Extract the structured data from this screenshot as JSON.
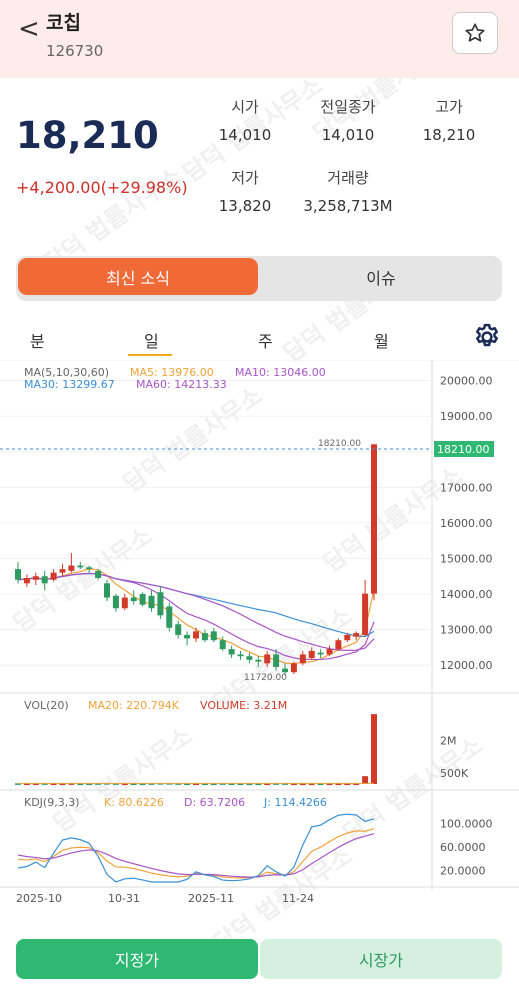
{
  "header": {
    "back_label": "<",
    "name": "코칩",
    "code": "126730"
  },
  "quote": {
    "price": "18,210",
    "change": "+4,200.00(+29.98%)",
    "stats": [
      {
        "label": "시가",
        "value": "14,010"
      },
      {
        "label": "전일종가",
        "value": "14,010"
      },
      {
        "label": "고가",
        "value": "18,210"
      },
      {
        "label": "저가",
        "value": "13,820"
      },
      {
        "label": "거래량",
        "value": "3,258,713M"
      }
    ]
  },
  "tabs": {
    "news": "최신 소식",
    "issues": "이슈"
  },
  "periods": [
    "분",
    "일",
    "주",
    "월"
  ],
  "chart": {
    "ma_header": "MA(5,10,30,60)",
    "ma5": "MA5: 13976.00",
    "ma10": "MA10: 13046.00",
    "ma30": "MA30: 13299.67",
    "ma60": "MA60: 14213.33",
    "max_label": "18210.00",
    "min_label": "11720.00",
    "last_price": "18210.00",
    "price_ticks": [
      "20000.00",
      "19000.00",
      "18000.00",
      "17000.00",
      "16000.00",
      "15000.00",
      "14000.00",
      "13000.00",
      "12000.00"
    ],
    "vol_header": "VOL(20)",
    "vol_ma": "MA20: 220.794K",
    "vol_value": "VOLUME: 3.21M",
    "vol_ticks": [
      "2M",
      "500K"
    ],
    "kdj_header": "KDJ(9,3,3)",
    "kdj_k": "K: 80.6226",
    "kdj_d": "D: 63.7206",
    "kdj_j": "J: 114.4266",
    "kdj_ticks": [
      "100.0000",
      "60.0000",
      "20.0000"
    ],
    "date_ticks": [
      "2025-10",
      "10-31",
      "2025-11",
      "11-24"
    ],
    "colors": {
      "up": "#d23a2a",
      "down": "#2e9a60",
      "ma5": "#f0a23a",
      "ma10": "#a855c8",
      "ma30": "#3a8fd6",
      "ma60": "#a855c8"
    }
  },
  "chart_data": {
    "type": "candlestick",
    "ylim": [
      11300,
      20300
    ],
    "candles": [
      {
        "o": 14700,
        "c": 14400,
        "h": 14900,
        "l": 14300
      },
      {
        "o": 14300,
        "c": 14450,
        "h": 14550,
        "l": 14200
      },
      {
        "o": 14400,
        "c": 14500,
        "h": 14600,
        "l": 14250
      },
      {
        "o": 14500,
        "c": 14300,
        "h": 14650,
        "l": 14100
      },
      {
        "o": 14400,
        "c": 14600,
        "h": 14700,
        "l": 14350
      },
      {
        "o": 14600,
        "c": 14700,
        "h": 14850,
        "l": 14500
      },
      {
        "o": 14650,
        "c": 14800,
        "h": 15150,
        "l": 14600
      },
      {
        "o": 14800,
        "c": 14750,
        "h": 14900,
        "l": 14700
      },
      {
        "o": 14750,
        "c": 14700,
        "h": 14800,
        "l": 14600
      },
      {
        "o": 14650,
        "c": 14450,
        "h": 14700,
        "l": 14400
      },
      {
        "o": 14300,
        "c": 13900,
        "h": 14400,
        "l": 13800
      },
      {
        "o": 13950,
        "c": 13600,
        "h": 14000,
        "l": 13500
      },
      {
        "o": 13600,
        "c": 13900,
        "h": 14000,
        "l": 13550
      },
      {
        "o": 13900,
        "c": 13800,
        "h": 14100,
        "l": 13700
      },
      {
        "o": 14000,
        "c": 13700,
        "h": 14050,
        "l": 13650
      },
      {
        "o": 13950,
        "c": 13600,
        "h": 14100,
        "l": 13500
      },
      {
        "o": 14050,
        "c": 13400,
        "h": 14200,
        "l": 13300
      },
      {
        "o": 13650,
        "c": 13050,
        "h": 13750,
        "l": 12950
      },
      {
        "o": 13150,
        "c": 12850,
        "h": 13250,
        "l": 12750
      },
      {
        "o": 12850,
        "c": 12750,
        "h": 12950,
        "l": 12550
      },
      {
        "o": 12750,
        "c": 12950,
        "h": 13050,
        "l": 12650
      },
      {
        "o": 12900,
        "c": 12700,
        "h": 13000,
        "l": 12650
      },
      {
        "o": 12950,
        "c": 12700,
        "h": 13050,
        "l": 12650
      },
      {
        "o": 12700,
        "c": 12450,
        "h": 12800,
        "l": 12400
      },
      {
        "o": 12450,
        "c": 12300,
        "h": 12550,
        "l": 12200
      },
      {
        "o": 12300,
        "c": 12250,
        "h": 12400,
        "l": 12150
      },
      {
        "o": 12250,
        "c": 12150,
        "h": 12350,
        "l": 12050
      },
      {
        "o": 12150,
        "c": 12100,
        "h": 12250,
        "l": 11950
      },
      {
        "o": 12050,
        "c": 12300,
        "h": 12400,
        "l": 11950
      },
      {
        "o": 12300,
        "c": 11950,
        "h": 12450,
        "l": 11850
      },
      {
        "o": 11900,
        "c": 11800,
        "h": 12050,
        "l": 11720
      },
      {
        "o": 11800,
        "c": 12050,
        "h": 12100,
        "l": 11750
      },
      {
        "o": 12050,
        "c": 12300,
        "h": 12400,
        "l": 12000
      },
      {
        "o": 12200,
        "c": 12400,
        "h": 12500,
        "l": 12150
      },
      {
        "o": 12350,
        "c": 12300,
        "h": 12450,
        "l": 12200
      },
      {
        "o": 12300,
        "c": 12450,
        "h": 12550,
        "l": 12250
      },
      {
        "o": 12450,
        "c": 12700,
        "h": 12750,
        "l": 12400
      },
      {
        "o": 12700,
        "c": 12850,
        "h": 12900,
        "l": 12650
      },
      {
        "o": 12800,
        "c": 12900,
        "h": 12950,
        "l": 12700
      },
      {
        "o": 12850,
        "c": 14010,
        "h": 14400,
        "l": 12800
      },
      {
        "o": 14010,
        "c": 18210,
        "h": 18210,
        "l": 13820
      }
    ],
    "volume": [
      0.03,
      0.02,
      0.02,
      0.03,
      0.02,
      0.02,
      0.03,
      0.02,
      0.02,
      0.03,
      0.04,
      0.03,
      0.02,
      0.02,
      0.02,
      0.03,
      0.04,
      0.04,
      0.03,
      0.02,
      0.02,
      0.02,
      0.02,
      0.03,
      0.02,
      0.02,
      0.02,
      0.02,
      0.02,
      0.03,
      0.03,
      0.02,
      0.02,
      0.02,
      0.02,
      0.02,
      0.02,
      0.02,
      0.02,
      0.36,
      3.21
    ],
    "vol_ylim": [
      0,
      3.4
    ],
    "kdj_ylim": [
      0,
      120
    ]
  }
}
